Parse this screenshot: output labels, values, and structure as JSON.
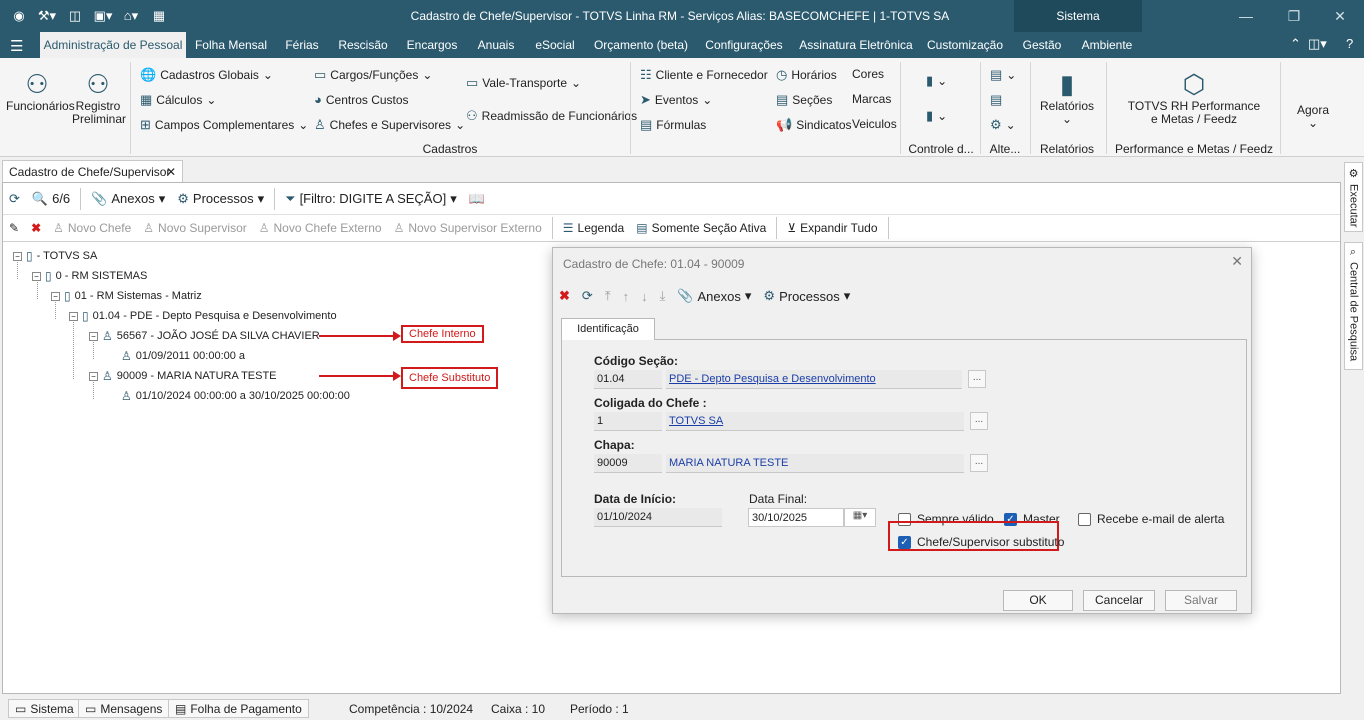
{
  "titlebar": {
    "title": "Cadastro de Chefe/Supervisor - TOTVS Linha RM - Serviços  Alias: BASECOMCHEFE | 1-TOTVS SA",
    "sistema": "Sistema"
  },
  "tabs": [
    "Administração de Pessoal",
    "Folha Mensal",
    "Férias",
    "Rescisão",
    "Encargos",
    "Anuais",
    "eSocial",
    "Orçamento (beta)",
    "Configurações",
    "Assinatura Eletrônica",
    "Customização",
    "Gestão",
    "Ambiente"
  ],
  "ribbon": {
    "funcionarios": "Funcionários",
    "registro": "Registro",
    "preliminar": "Preliminar",
    "cadastros_globais": "Cadastros Globais",
    "calculos": "Cálculos",
    "campos_comp": "Campos Complementares",
    "cargos": "Cargos/Funções",
    "centros": "Centros Custos",
    "chefes": "Chefes e Supervisores",
    "vale": "Vale-Transporte",
    "readmissao": "Readmissão de Funcionários",
    "cliente": "Cliente e Fornecedor",
    "eventos": "Eventos",
    "formulas": "Fórmulas",
    "horarios": "Horários",
    "secoes": "Seções",
    "sindicatos": "Sindicatos",
    "cores": "Cores",
    "marcas": "Marcas",
    "veiculos": "Veiculos",
    "relatorios": "Relatórios",
    "totvs_rh_1": "TOTVS RH Performance",
    "totvs_rh_2": "e Metas / Feedz",
    "agora": "Agora",
    "grp_cadastros": "Cadastros",
    "grp_controle": "Controle d...",
    "grp_alte": "Alte...",
    "grp_relatorios": "Relatórios",
    "grp_perf": "Performance e Metas / Feedz"
  },
  "doc_tab": "Cadastro de Chefe/Supervisor",
  "toolbar1": {
    "count": "6/6",
    "anexos": "Anexos",
    "processos": "Processos",
    "filtro": "[Filtro: DIGITE A SEÇÃO]"
  },
  "toolbar2": {
    "novo_chefe": "Novo Chefe",
    "novo_supervisor": "Novo Supervisor",
    "novo_chefe_ext": "Novo Chefe Externo",
    "novo_sup_ext": "Novo Supervisor Externo",
    "legenda": "Legenda",
    "somente": "Somente Seção Ativa",
    "expandir": "Expandir Tudo"
  },
  "tree": {
    "n0": "- TOTVS SA",
    "n1": "0 - RM SISTEMAS",
    "n2": "01 - RM Sistemas - Matriz",
    "n3": "01.04 - PDE - Depto Pesquisa e Desenvolvimento",
    "n4": "56567 - JOÃO JOSÉ DA SILVA CHAVIER",
    "n5": "01/09/2011 00:00:00 a",
    "n6": "90009 - MARIA NATURA TESTE",
    "n7": "01/10/2024 00:00:00 a 30/10/2025 00:00:00"
  },
  "callouts": {
    "interno": "Chefe Interno",
    "substituto": "Chefe Substituto"
  },
  "dialog": {
    "title": "Cadastro de Chefe: 01.04 - 90009",
    "anexos": "Anexos",
    "processos": "Processos",
    "tab": "Identificação",
    "codigo_label": "Código Seção:",
    "codigo": "01.04",
    "codigo_desc": "PDE - Depto Pesquisa e Desenvolvimento",
    "coligada_label": "Coligada do Chefe :",
    "coligada": "1",
    "coligada_desc": "TOTVS SA",
    "chapa_label": "Chapa:",
    "chapa": "90009",
    "chapa_desc": "MARIA NATURA TESTE",
    "inicio_label": "Data de Início:",
    "inicio": "01/10/2024",
    "final_label": "Data Final:",
    "final": "30/10/2025",
    "sempre": "Sempre válido",
    "master": "Master",
    "recebe": "Recebe e-mail de alerta",
    "substituto": "Chefe/Supervisor substituto",
    "ok": "OK",
    "cancelar": "Cancelar",
    "salvar": "Salvar",
    "dots": "..."
  },
  "rightbar": {
    "executar": "Executar",
    "central": "Central de Pesquisa"
  },
  "status": {
    "sistema": "Sistema",
    "mensagens": "Mensagens",
    "folha": "Folha de Pagamento",
    "competencia": "Competência : 10/2024",
    "caixa": "Caixa : 10",
    "periodo": "Período : 1"
  },
  "colors": {
    "titlebar": "#2b5a6e",
    "callout": "#d21a1a",
    "checkbox": "#1d5fb5",
    "link": "#1a3ea8"
  }
}
